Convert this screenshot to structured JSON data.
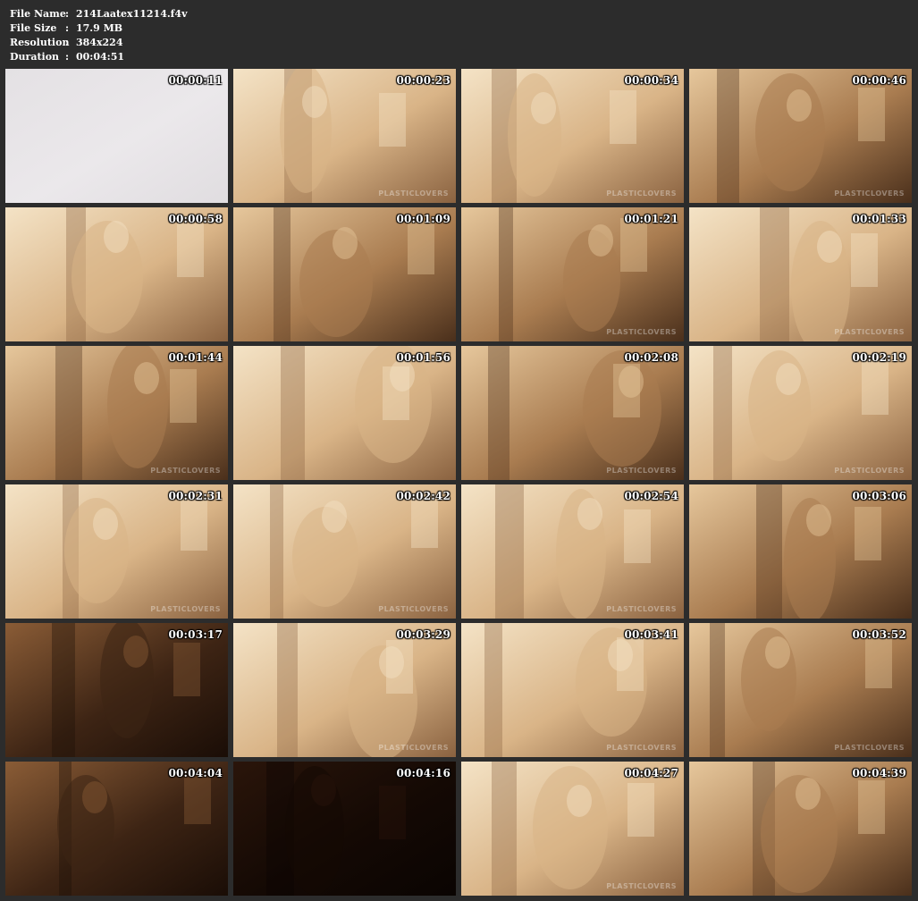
{
  "file_info": {
    "name_label": "File Name",
    "name_value": "214Laatex11214.f4v",
    "size_label": "File Size",
    "size_value": "17.9 MB",
    "resolution_label": "Resolution",
    "resolution_value": "384x224",
    "duration_label": "Duration",
    "duration_value": "00:04:51",
    "separator": ":"
  },
  "watermark": "PLASTICLOVERS",
  "colors": {
    "background": "#2c2c2c",
    "sepia_light": "#ecd3ae",
    "sepia_mid": "#b98d5e",
    "sepia_dark": "#3a2414"
  },
  "thumbnails": [
    {
      "time": "00:00:11",
      "watermark": false,
      "tone": "blank"
    },
    {
      "time": "00:00:23",
      "watermark": true,
      "tone": "bright"
    },
    {
      "time": "00:00:34",
      "watermark": true,
      "tone": "bright"
    },
    {
      "time": "00:00:46",
      "watermark": true,
      "tone": "mid"
    },
    {
      "time": "00:00:58",
      "watermark": false,
      "tone": "bright"
    },
    {
      "time": "00:01:09",
      "watermark": false,
      "tone": "mid"
    },
    {
      "time": "00:01:21",
      "watermark": true,
      "tone": "mid"
    },
    {
      "time": "00:01:33",
      "watermark": true,
      "tone": "bright"
    },
    {
      "time": "00:01:44",
      "watermark": true,
      "tone": "mid"
    },
    {
      "time": "00:01:56",
      "watermark": false,
      "tone": "bright"
    },
    {
      "time": "00:02:08",
      "watermark": true,
      "tone": "mid"
    },
    {
      "time": "00:02:19",
      "watermark": true,
      "tone": "bright"
    },
    {
      "time": "00:02:31",
      "watermark": true,
      "tone": "bright"
    },
    {
      "time": "00:02:42",
      "watermark": true,
      "tone": "bright"
    },
    {
      "time": "00:02:54",
      "watermark": true,
      "tone": "bright"
    },
    {
      "time": "00:03:06",
      "watermark": false,
      "tone": "mid"
    },
    {
      "time": "00:03:17",
      "watermark": false,
      "tone": "dark"
    },
    {
      "time": "00:03:29",
      "watermark": true,
      "tone": "bright"
    },
    {
      "time": "00:03:41",
      "watermark": true,
      "tone": "bright"
    },
    {
      "time": "00:03:52",
      "watermark": true,
      "tone": "mid"
    },
    {
      "time": "00:04:04",
      "watermark": false,
      "tone": "dark"
    },
    {
      "time": "00:04:16",
      "watermark": false,
      "tone": "black"
    },
    {
      "time": "00:04:27",
      "watermark": true,
      "tone": "bright"
    },
    {
      "time": "00:04:39",
      "watermark": false,
      "tone": "mid"
    }
  ]
}
